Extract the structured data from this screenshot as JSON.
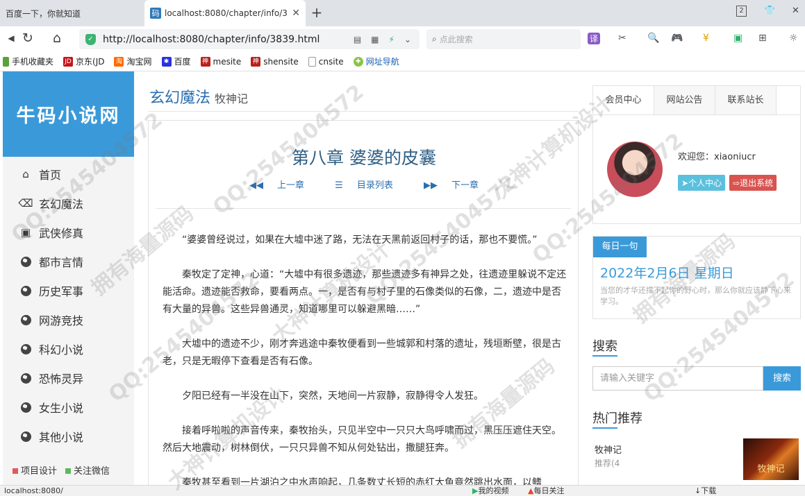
{
  "browser": {
    "tabs": [
      {
        "label": "百度一下，你就知道",
        "active": false
      },
      {
        "label": "localhost:8080/chapter/info/3",
        "active": true,
        "icon": "码"
      }
    ],
    "tab_count": "2",
    "url": "http://localhost:8080/chapter/info/3839.html",
    "search_placeholder": "点此搜索",
    "bookmarks": [
      {
        "label": "手机收藏夹",
        "icon": "phone-icon"
      },
      {
        "label": "京东(JD",
        "icon": "JD"
      },
      {
        "label": "淘宝网",
        "icon": "taobao-icon"
      },
      {
        "label": "百度",
        "icon": "baidu-paw-icon"
      },
      {
        "label": "mesite",
        "icon": "mesite-icon"
      },
      {
        "label": "shensite",
        "icon": "shensite-icon"
      },
      {
        "label": "cnsite",
        "icon": "page-icon"
      },
      {
        "label": "网址导航",
        "icon": "nav-icon"
      }
    ],
    "status_url": "localhost:8080/",
    "status_items": [
      "我的视频",
      "每日关注",
      "下载"
    ]
  },
  "sidebar": {
    "logo": "牛码小说网",
    "items": [
      {
        "label": "首页",
        "icon": "home-icon"
      },
      {
        "label": "玄幻魔法",
        "icon": "eraser-icon"
      },
      {
        "label": "武侠修真",
        "icon": "inbox-icon"
      },
      {
        "label": "都市言情",
        "icon": "globe-icon"
      },
      {
        "label": "历史军事",
        "icon": "globe-icon"
      },
      {
        "label": "网游竞技",
        "icon": "globe-icon"
      },
      {
        "label": "科幻小说",
        "icon": "globe-icon"
      },
      {
        "label": "恐怖灵异",
        "icon": "globe-icon"
      },
      {
        "label": "女生小说",
        "icon": "globe-icon"
      },
      {
        "label": "其他小说",
        "icon": "globe-icon"
      }
    ],
    "footer": [
      {
        "label": "项目设计",
        "color": "#e05a5a"
      },
      {
        "label": "关注微信",
        "color": "#5cb85c"
      }
    ]
  },
  "content": {
    "category": "玄幻魔法",
    "book": "牧神记",
    "chapter_title": "第八章 婆婆的皮囊",
    "nav": {
      "prev": "上一章",
      "list": "目录列表",
      "next": "下一章"
    },
    "paragraphs": [
      "“婆婆曾经说过，如果在大墟中迷了路，无法在天黑前返回村子的话，那也不要慌。”",
      "秦牧定了定神，心道：“大墟中有很多遗迹，那些遗迹多有神异之处，往遗迹里躲说不定还能活命。遗迹能否救命，要看两点。一，是否有与村子里的石像类似的石像，二，遗迹中是否有大量的异兽。这些异兽通灵，知道哪里可以躲避黑暗……”",
      "大墟中的遗迹不少，刚才奔逃途中秦牧便看到一些城郭和村落的遗址，残垣断壁，很是古老，只是无暇停下查看是否有石像。",
      "夕阳已经有一半没在山下，突然，天地间一片寂静，寂静得令人发狂。",
      "接着呼啦啦的声音传来，秦牧抬头，只见半空中一只只大鸟呼啸而过，黑压压遮住天空。然后大地震动，树林倒伏，一只只异兽不知从何处钻出，撒腿狂奔。",
      "秦牧甚至看到一片湖泊之中水声响起，几条数丈长短的赤红大鱼竟然跳出水面，以鳍"
    ]
  },
  "right": {
    "tabs": [
      "会员中心",
      "网站公告",
      "联系站长"
    ],
    "welcome": "欢迎您：xiaoniucr",
    "btn_profile": "个人中心",
    "btn_logout": "退出系统",
    "daily_label": "每日一句",
    "daily_date": "2022年2月6日 星期日",
    "daily_quote": "当您的才华还撑不起你的野心时，那么你就应该静下心来学习。",
    "search_title": "搜索",
    "search_placeholder": "请输入关键字",
    "search_btn": "搜索",
    "hot_title": "热门推荐",
    "hot_name": "牧神记",
    "hot_sub": "推荐(4",
    "cover_text": "牧神记"
  },
  "watermarks": [
    "QQ:2545404572",
    "拥有海量源码",
    "大神计算机设计"
  ]
}
